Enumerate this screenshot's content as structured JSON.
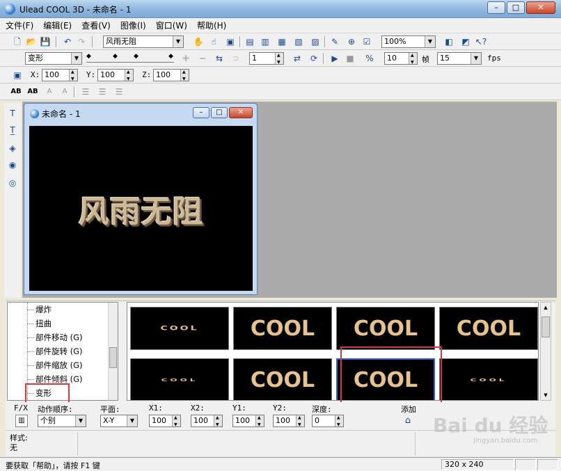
{
  "window": {
    "title": "Ulead COOL 3D - 未命名 - 1",
    "min": "–",
    "max": "□",
    "close": "✕"
  },
  "menu": [
    "文件(F)",
    "编辑(E)",
    "查看(V)",
    "图像(I)",
    "窗口(W)",
    "帮助(H)"
  ],
  "toolbar1": {
    "text_object": "风雨无阻",
    "zoom": "100%"
  },
  "toolbar2": {
    "effect": "变形",
    "frame": "1",
    "speed": "10",
    "frames_label": "帧",
    "fps_value": "15",
    "fps_label": "fps"
  },
  "toolbar3": {
    "x_label": "X:",
    "x": "100",
    "y_label": "Y:",
    "y": "100",
    "z_label": "Z:",
    "z": "100"
  },
  "toolbar4": {
    "ab1": "AB",
    "ab2": "AB",
    "ab3": "A",
    "ab4": "A"
  },
  "document": {
    "title": "未命名 - 1",
    "canvas_text": "风雨无阻"
  },
  "tree_items": [
    "爆炸",
    "扭曲",
    "部件移动 (G)",
    "部件旋转 (G)",
    "部件缩放 (G)",
    "部件倾斜 (G)",
    "变形"
  ],
  "gallery": [
    "COOL",
    "COOL",
    "COOL",
    "COOL",
    "COOL",
    "COOL",
    "COOL",
    "COOL"
  ],
  "params": {
    "fx": "F/X",
    "order_label": "动作顺序:",
    "order": "个别",
    "plane_label": "平面:",
    "plane": "X-Y",
    "x1_label": "X1:",
    "x1": "100",
    "x2_label": "X2:",
    "x2": "100",
    "y1_label": "Y1:",
    "y1": "100",
    "y2_label": "Y2:",
    "y2": "100",
    "depth_label": "深度:",
    "depth": "0",
    "add_label": "添加"
  },
  "style": {
    "label": "样式:",
    "value": "无"
  },
  "status": {
    "text": "要获取「帮助」，请按 F1 键",
    "size": "320 x 240"
  },
  "watermark": {
    "main": "Bai du 经验",
    "sub": "jingyan.baidu.com"
  },
  "colors": {
    "highlight": "#d9363e",
    "canvas": "#000000",
    "text_gold": "#cdb897"
  }
}
